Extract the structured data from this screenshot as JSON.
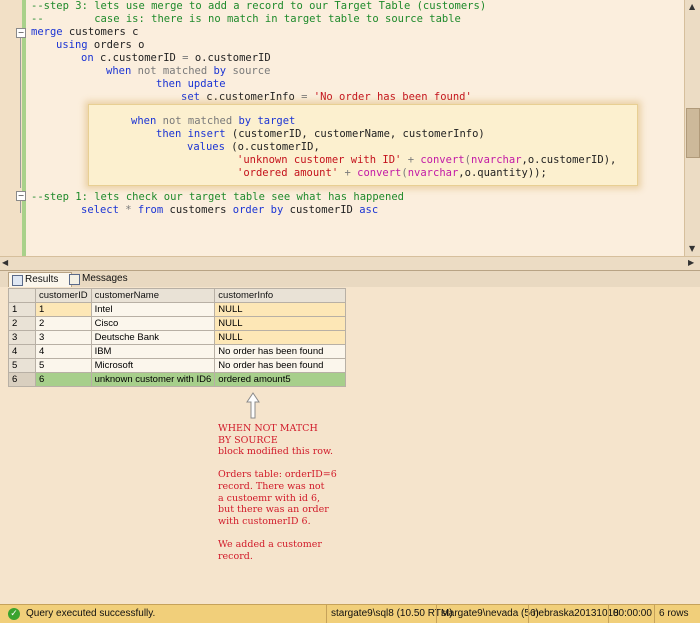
{
  "editor": {
    "lines": {
      "l1": "--step 3: lets use merge to add a record to our Target Table (customers)",
      "l2a": "--",
      "l2b": "case is: there is no match in target table to source table",
      "l3a": "merge",
      "l3b": " customers c",
      "l4a": "using",
      "l4b": " orders o",
      "l5a": "on",
      "l5b": " c.customerID ",
      "l5c": "=",
      "l5d": " o.customerID",
      "l6a": "when",
      "l6b": " not matched ",
      "l6c": "by",
      "l6d": " source",
      "l7a": "then update",
      "l8a": "set",
      "l8b": " c.customerInfo ",
      "l8c": "=",
      "l8d": " 'No order has been found'",
      "l9": "--step 1: lets check our target table see what has happened",
      "l10a": "select",
      "l10b": " * ",
      "l10c": "from",
      "l10d": " customers ",
      "l10e": "order by",
      "l10f": " customerID ",
      "l10g": "asc"
    },
    "popup": {
      "p1a": "when",
      "p1b": " not matched ",
      "p1c": "by target",
      "p2a": "then insert",
      "p2b": " (customerID, customerName, customerInfo)",
      "p3a": "values",
      "p3b": " (o.customerID,",
      "p4a": "'unknown customer with ID'",
      "p4b": " + ",
      "p4c": "convert",
      "p4d": "(",
      "p4e": "nvarchar",
      "p4f": ",o.customerID),",
      "p5a": "'ordered amount'",
      "p5b": " + ",
      "p5c": "convert",
      "p5d": "(",
      "p5e": "nvarchar",
      "p5f": ",o.quantity));"
    }
  },
  "tabs": {
    "results": "Results",
    "messages": "Messages"
  },
  "grid": {
    "headers": [
      "customerID",
      "customerName",
      "customerInfo"
    ],
    "rows": [
      {
        "n": "1",
        "id": "1",
        "name": "Intel",
        "info": "NULL"
      },
      {
        "n": "2",
        "id": "2",
        "name": "Cisco",
        "info": "NULL"
      },
      {
        "n": "3",
        "id": "3",
        "name": "Deutsche Bank",
        "info": "NULL"
      },
      {
        "n": "4",
        "id": "4",
        "name": "IBM",
        "info": "No order has been found"
      },
      {
        "n": "5",
        "id": "5",
        "name": "Microsoft",
        "info": "No order has been found"
      },
      {
        "n": "6",
        "id": "6",
        "name": "unknown customer with ID6",
        "info": "ordered amount5"
      }
    ]
  },
  "annotation": "WHEN NOT MATCH\nBY SOURCE\nblock modified this row.\n\nOrders table: orderID=6\nrecord. There was not\na custoemr with id 6,\nbut there was an order\nwith customerID 6.\n\nWe added a customer\nrecord.",
  "status": {
    "message": "Query executed successfully.",
    "server": "stargate9\\sql8 (10.50 RTM)",
    "user": "stargate9\\nevada (56)",
    "database": "nebraska20131018",
    "time": "00:00:00",
    "rows": "6 rows"
  },
  "colors": {
    "editor_bg": "#fbeedd",
    "keyword": "#1b34d4",
    "comment": "#1f8a2b",
    "string": "#c4121c",
    "status_bg": "#f1cf7a",
    "annotation": "#d11b2a"
  }
}
